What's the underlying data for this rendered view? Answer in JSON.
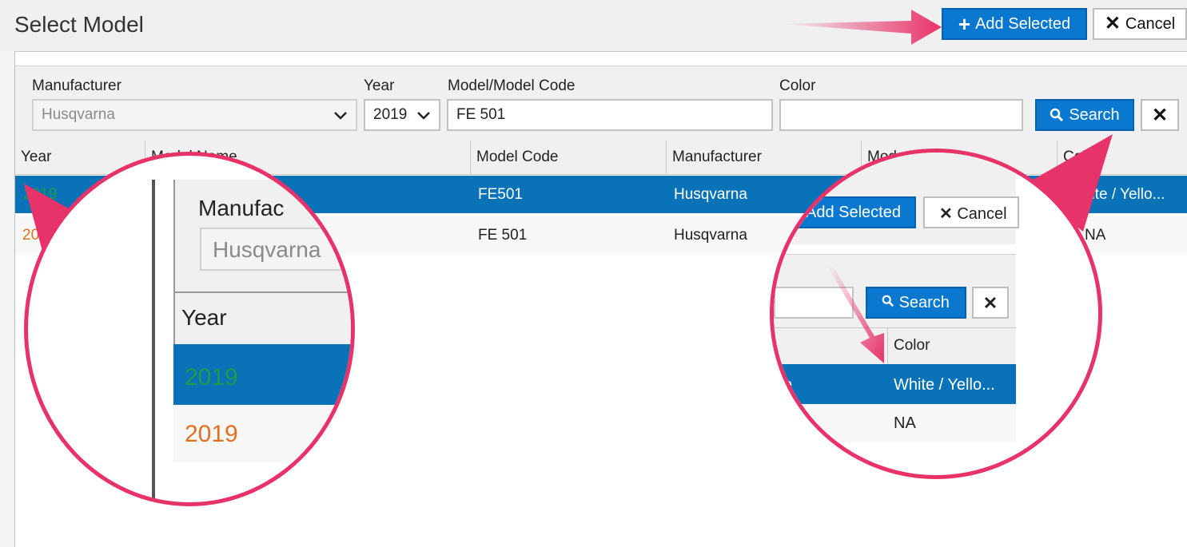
{
  "dialog": {
    "title": "Select Model",
    "add_selected_label": "Add Selected",
    "cancel_label": "Cancel"
  },
  "filters": {
    "manufacturer_label": "Manufacturer",
    "manufacturer_value": "Husqvarna",
    "year_label": "Year",
    "year_value": "2019",
    "model_label": "Model/Model Code",
    "model_value": "FE 501",
    "color_label": "Color",
    "color_value": "",
    "search_label": "Search"
  },
  "grid": {
    "columns": [
      "Year",
      "Model Name",
      "Model Code",
      "Manufacturer",
      "Mod",
      "Color"
    ],
    "rows": [
      {
        "year": "2019",
        "model_name": "",
        "model_code": "FE501",
        "manufacturer": "Husqvarna",
        "color": "White / Yello...",
        "selected": true
      },
      {
        "year": "2019",
        "model_name": "",
        "model_code": "FE 501",
        "manufacturer": "Husqvarna",
        "color": "NA",
        "selected": false
      }
    ]
  },
  "zoom_left": {
    "manufacturer_label": "Manufac",
    "manufacturer_value": "Husqvarna",
    "year_header": "Year",
    "row1_year": "2019",
    "row2_year": "2019"
  },
  "zoom_right": {
    "add_selected_label": "Add Selected",
    "cancel_label": "Cancel",
    "search_label": "Search",
    "color_header": "Color",
    "row1_prefix": "e",
    "row1_color": "White / Yello...",
    "row2_color": "NA"
  },
  "colors": {
    "accent": "#0a78cf",
    "selected_row": "#0a72b7",
    "year_selected": "#1f9a4a",
    "year_normal": "#e07020",
    "callout": "#e8336a"
  }
}
